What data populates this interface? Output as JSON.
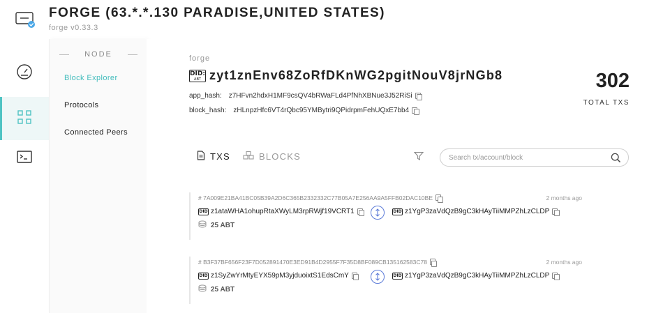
{
  "header": {
    "title": "FORGE (63.*.*.130 PARADISE,UNITED STATES)",
    "version": "forge v0.33.3"
  },
  "rail": {
    "items": [
      {
        "icon": "dashboard-gauge-icon",
        "active": false
      },
      {
        "icon": "grid-nodes-icon",
        "active": true
      },
      {
        "icon": "terminal-icon",
        "active": false
      }
    ]
  },
  "menu": {
    "header": "NODE",
    "items": [
      {
        "label": "Block Explorer",
        "active": true
      },
      {
        "label": "Protocols",
        "active": false
      },
      {
        "label": "Connected Peers",
        "active": false
      }
    ]
  },
  "chain": {
    "label": "forge",
    "did_badge": "DID:",
    "did_badge_sub": "ABT",
    "address": "zyt1znEnv68ZoRfDKnWG2pgitNouV8jrNGb8",
    "app_hash_label": "app_hash:",
    "app_hash": "z7HFvn2hdxH1MF9csQV4bRWaFLd4PfNhXBNue3J52RiSi",
    "block_hash_label": "block_hash:",
    "block_hash": "zHLnpzHfc6VT4rQbc95YMBytri9QPidrpmFehUQxE7bb4"
  },
  "stats": {
    "total_txs": "302",
    "total_txs_label": "TOTAL TXS"
  },
  "tabs": [
    {
      "label": "TXS",
      "icon": "document-icon",
      "active": true
    },
    {
      "label": "BLOCKS",
      "icon": "blocks-icon",
      "active": false
    }
  ],
  "search": {
    "placeholder": "Search tx/account/block",
    "value": ""
  },
  "transactions": [
    {
      "hash": "# 7A009E21BA41BC05B39A2D6C365B2332332C77B05A7E256AA9A5FFB02DAC10BE",
      "time": "2 months ago",
      "from": "z1ataWHA1ohupRtaXWyLM3rpRWjf19VCRT1",
      "to": "z1YgP3zaVdQzB9gC3kHAyTiiMMPZhLzCLDP",
      "amount": "25 ABT"
    },
    {
      "hash": "# B3F37BF656F23F7D052891470E3ED91B4D2955F7F35D8BF089CB135162583C78",
      "time": "2 months ago",
      "from": "z1SyZwYrMtyEYX59pM3yjduoixtS1EdsCmY",
      "to": "z1YgP3zaVdQzB9gC3kHAyTiiMMPZhLzCLDP",
      "amount": "25 ABT"
    }
  ],
  "colors": {
    "accent": "#42bcbc",
    "transfer_icon": "#5c7bd8",
    "text": "#222222"
  }
}
